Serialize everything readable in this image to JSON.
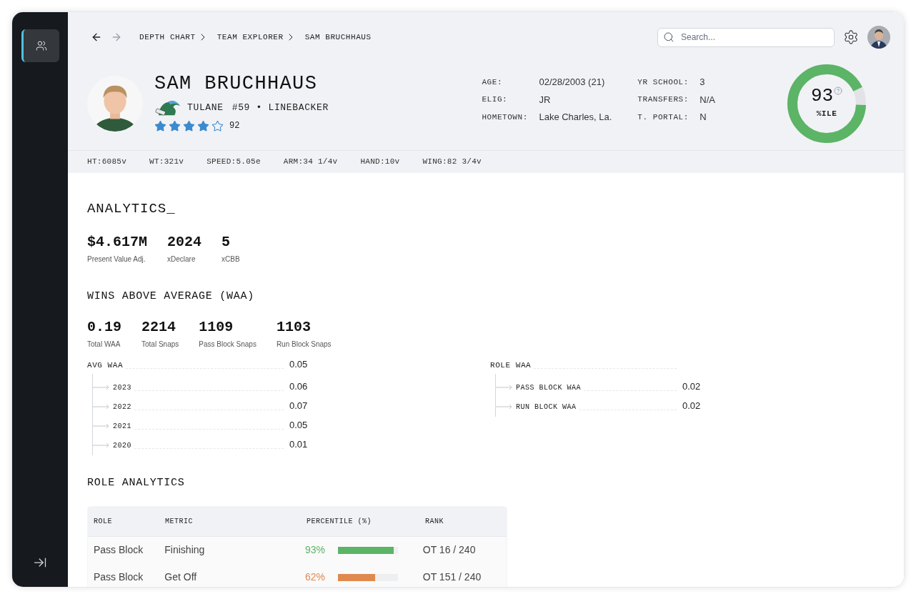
{
  "sidebar": {
    "items": [
      {
        "selected": true
      }
    ]
  },
  "nav": {
    "back_disabled": false,
    "forward_disabled": true
  },
  "breadcrumbs": [
    "DEPTH CHART",
    "TEAM EXPLORER",
    "SAM BRUCHHAUS"
  ],
  "search": {
    "placeholder": "Search..."
  },
  "player": {
    "name": "SAM BRUCHHAUS",
    "team": "TULANE",
    "number_position": "#59 • LINEBACKER",
    "stars": 4,
    "rating": "92"
  },
  "bio_left": [
    {
      "label": "AGE:",
      "value": "02/28/2003 (21)"
    },
    {
      "label": "ELIG:",
      "value": "JR"
    },
    {
      "label": "HOMETOWN:",
      "value": "Lake Charles, La."
    }
  ],
  "bio_right": [
    {
      "label": "YR SCHOOL:",
      "value": "3"
    },
    {
      "label": "TRANSFERS:",
      "value": "N/A"
    },
    {
      "label": "T. PORTAL:",
      "value": "N"
    }
  ],
  "percentile": {
    "value": "93",
    "label": "%ILE",
    "level": 0.93
  },
  "measurements": [
    "HT:6085v",
    "WT:321v",
    "SPEED:5.05e",
    "ARM:34 1/4v",
    "HAND:10v",
    "WING:82 3/4v"
  ],
  "analytics": {
    "title": "ANALYTICS_",
    "stats": [
      {
        "value": "$4.617M",
        "label": "Present Value Adj."
      },
      {
        "value": "2024",
        "label": "xDeclare"
      },
      {
        "value": "5",
        "label": "xCBB"
      }
    ]
  },
  "waa": {
    "title": "WINS ABOVE AVERAGE (WAA)",
    "stats": [
      {
        "value": "0.19",
        "label": "Total WAA"
      },
      {
        "value": "2214",
        "label": "Total Snaps"
      },
      {
        "value": "1109",
        "label": "Pass Block Snaps"
      },
      {
        "value": "1103",
        "label": "Run Block Snaps"
      }
    ],
    "trees": [
      {
        "label": "AVG WAA",
        "value": "0.05",
        "children": [
          {
            "label": "2023",
            "value": "0.06"
          },
          {
            "label": "2022",
            "value": "0.07"
          },
          {
            "label": "2021",
            "value": "0.05"
          },
          {
            "label": "2020",
            "value": "0.01"
          }
        ]
      },
      {
        "label": "ROLE WAA",
        "children": [
          {
            "label": "PASS BLOCK WAA",
            "value": "0.02"
          },
          {
            "label": "RUN BLOCK WAA",
            "value": "0.02"
          }
        ]
      }
    ]
  },
  "role_analytics": {
    "title": "ROLE ANALYTICS",
    "columns": [
      "ROLE",
      "METRIC",
      "PERCENTILE (%)",
      "RANK"
    ],
    "rows": [
      {
        "role": "Pass Block",
        "metric": "Finishing",
        "percentile": "93%",
        "level": 0.93,
        "color": "#5cb466",
        "rank": "OT 16 / 240"
      },
      {
        "role": "Pass Block",
        "metric": "Get Off",
        "percentile": "62%",
        "level": 0.62,
        "color": "#e0894f",
        "rank": "OT 151 / 240"
      }
    ]
  }
}
